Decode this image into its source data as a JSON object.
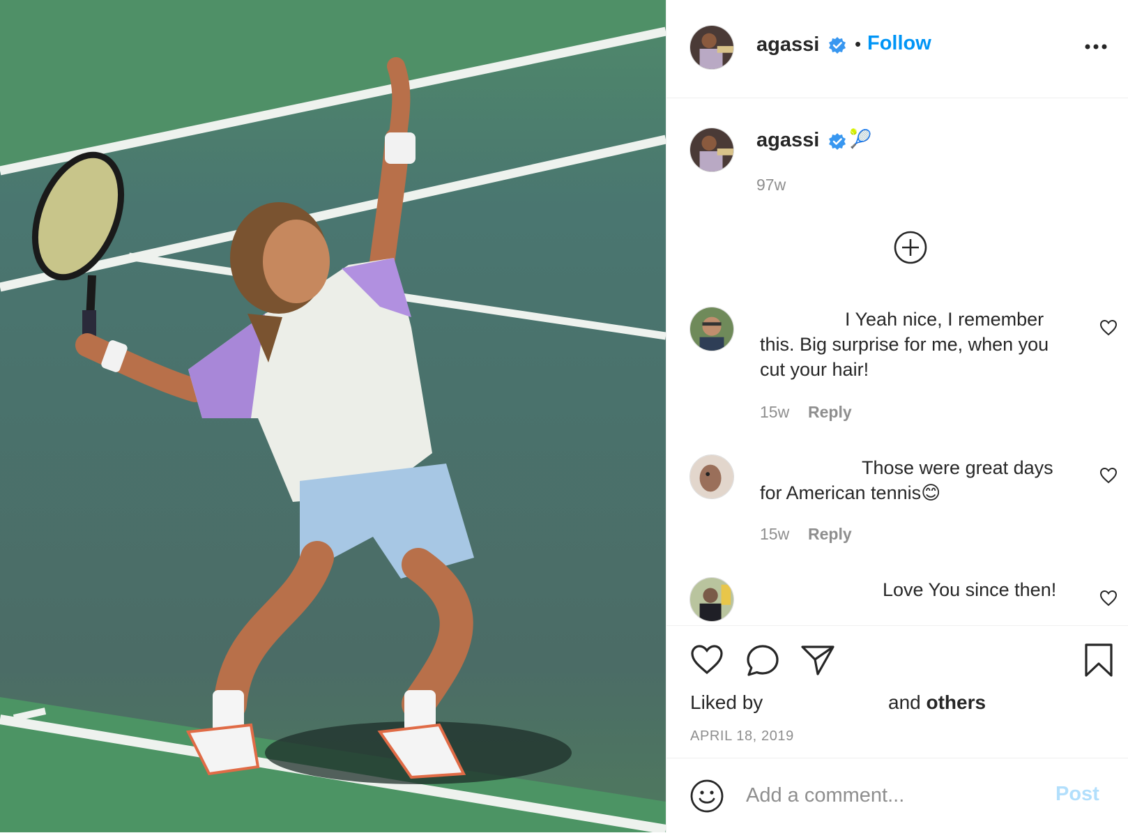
{
  "post": {
    "username": "agassi",
    "follow_label": "Follow",
    "separator": "•",
    "caption_emoji": "🎾",
    "caption_time": "97w",
    "date": "APRIL 18, 2019"
  },
  "comments": [
    {
      "text": "I Yeah nice, I remember this. Big surprise for me, when you cut your hair!",
      "time": "15w",
      "reply_label": "Reply"
    },
    {
      "text": "Those were great days for American tennis😊",
      "time": "15w",
      "reply_label": "Reply"
    },
    {
      "text": "Love You since then!"
    }
  ],
  "likes": {
    "prefix": "Liked by",
    "suffix_and": "and",
    "suffix_others": "others"
  },
  "composer": {
    "placeholder": "Add a comment...",
    "post_label": "Post"
  },
  "colors": {
    "accent": "#0095f6",
    "verified": "#3897f0",
    "muted": "#8e8e8e",
    "post_disabled": "#b2dffc"
  },
  "icons": {
    "verified": "verified-badge-icon",
    "more": "more-options-icon",
    "load_more": "plus-circle-icon",
    "comment_like": "heart-outline-icon",
    "like": "heart-icon",
    "comment": "comment-bubble-icon",
    "share": "paper-plane-icon",
    "save": "bookmark-icon",
    "emoji": "smiley-icon"
  }
}
